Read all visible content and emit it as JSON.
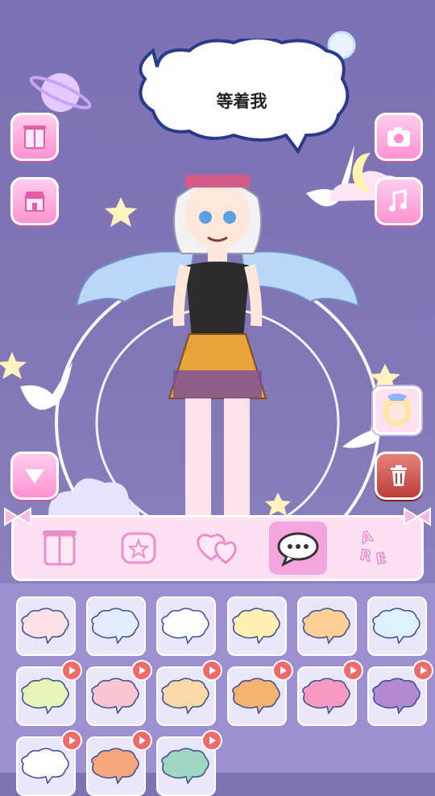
{
  "speech": {
    "text": "等着我"
  },
  "colors": {
    "accent": "#ff8fd0",
    "active_tab": "#f4a6dc",
    "background": "#7e74b4",
    "delete": "#b83b37"
  },
  "left_buttons": [
    {
      "name": "wardrobe-button",
      "icon": "wardrobe-icon"
    },
    {
      "name": "shop-button",
      "icon": "shop-icon"
    },
    {
      "name": "collapse-button",
      "icon": "triangle-down-icon"
    }
  ],
  "right_buttons": [
    {
      "name": "camera-button",
      "icon": "camera-icon"
    },
    {
      "name": "music-button",
      "icon": "music-note-icon"
    },
    {
      "name": "character-thumbnail-button",
      "icon": "character-avatar"
    },
    {
      "name": "delete-button",
      "icon": "trash-icon"
    }
  ],
  "tabs": [
    {
      "name": "tab-clothes",
      "icon": "wardrobe-icon",
      "active": false
    },
    {
      "name": "tab-stickers",
      "icon": "star-box-icon",
      "active": false
    },
    {
      "name": "tab-hearts",
      "icon": "hearts-icon",
      "active": false
    },
    {
      "name": "tab-speech-bubbles",
      "icon": "speech-bubble-icon",
      "active": true
    },
    {
      "name": "tab-text",
      "icon": "letters-icon",
      "active": false
    }
  ],
  "bubbles": [
    {
      "name": "bubble-cloud-pink",
      "locked": false
    },
    {
      "name": "bubble-jagged-blue",
      "locked": false
    },
    {
      "name": "bubble-round-white",
      "locked": false
    },
    {
      "name": "bubble-zigzag-yellow",
      "locked": false
    },
    {
      "name": "bubble-orange-check",
      "locked": false
    },
    {
      "name": "bubble-blue-cloud",
      "locked": false
    },
    {
      "name": "bubble-green-rect",
      "locked": true
    },
    {
      "name": "bubble-plaid-pink",
      "locked": true
    },
    {
      "name": "bubble-shiba",
      "locked": true
    },
    {
      "name": "bubble-cat-orange",
      "locked": true
    },
    {
      "name": "bubble-pink-envelope",
      "locked": true
    },
    {
      "name": "bubble-purple-stripe",
      "locked": true
    },
    {
      "name": "bubble-sheep",
      "locked": true
    },
    {
      "name": "bubble-orange-cat",
      "locked": true
    },
    {
      "name": "bubble-teal-check",
      "locked": true
    }
  ]
}
